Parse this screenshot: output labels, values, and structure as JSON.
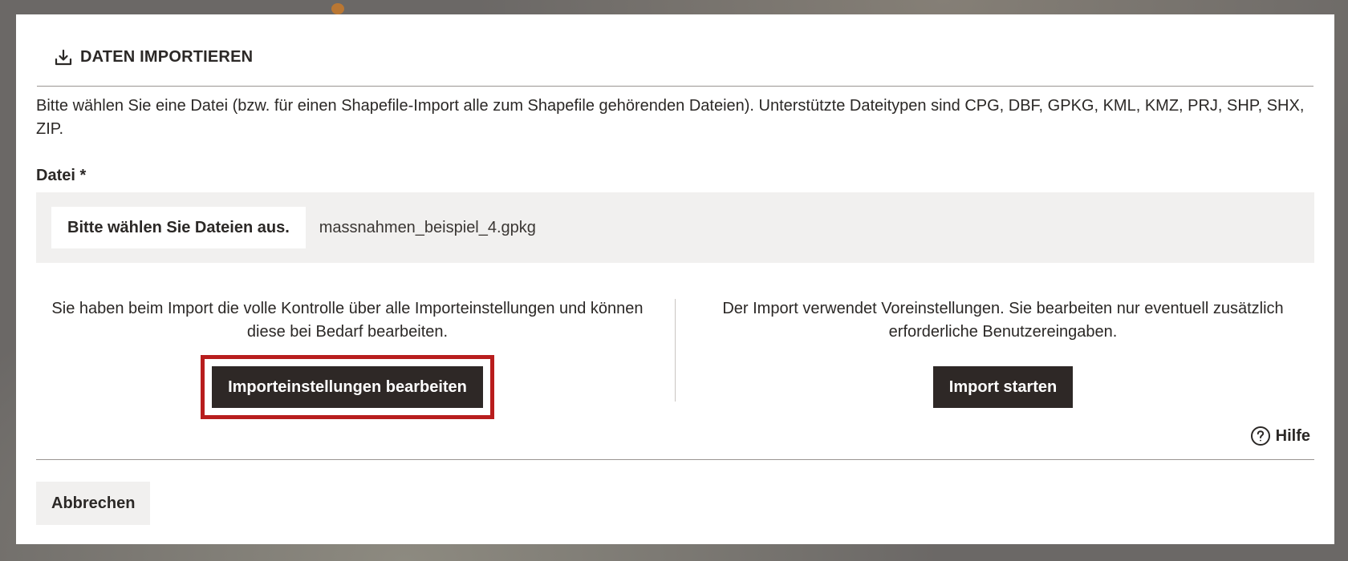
{
  "dialog": {
    "title": "DATEN IMPORTIEREN",
    "title_icon": "import-download-icon",
    "intro": "Bitte wählen Sie eine Datei (bzw. für einen Shapefile-Import alle zum Shapefile gehörenden Dateien). Unterstützte Dateitypen sind CPG, DBF, GPKG, KML, KMZ, PRJ, SHP, SHX, ZIP.",
    "file_field": {
      "label": "Datei *",
      "button_label": "Bitte wählen Sie Dateien aus.",
      "selected_file": "massnahmen_beispiel_4.gpkg"
    },
    "options": {
      "custom": {
        "text": "Sie haben beim Import die volle Kontrolle über alle Importeinstellungen und können diese bei Bedarf bearbeiten.",
        "button_label": "Importeinstellungen bearbeiten"
      },
      "quick": {
        "text": "Der Import verwendet Voreinstellungen. Sie bearbeiten nur eventuell zusätzlich erforderliche Benutzereingaben.",
        "button_label": "Import starten"
      }
    },
    "help": {
      "label": "Hilfe",
      "icon": "question-circle-icon"
    },
    "cancel_label": "Abbrechen"
  },
  "colors": {
    "overlay": "#6f6c69",
    "dark_button": "#2e2826",
    "highlight": "#b81d1d",
    "field_background": "#f1f0ef"
  }
}
